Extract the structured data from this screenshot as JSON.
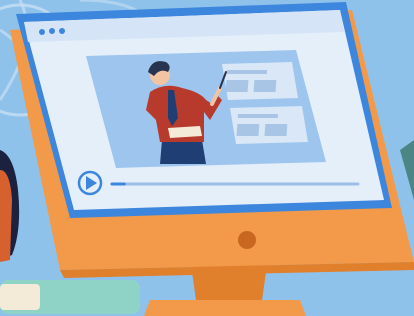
{
  "scene": {
    "description_icon": "e-learning-monitor-illustration",
    "colors": {
      "background": "#8fc2ea",
      "monitor_body": "#f29a4a",
      "monitor_body_dark": "#e07f2c",
      "bezel_blue": "#3d86dd",
      "screen": "#e4effa",
      "titlebar": "#d5e4f6",
      "video_area": "#9ec5ee",
      "slide_panel": "#d9e7f7",
      "slide_lines": "#a9c5e6",
      "shirt": "#b73a2c",
      "tie": "#1f3e73",
      "pants": "#1f3e73",
      "hair": "#27334f",
      "skin": "#f2c4a2",
      "play_button": "#3d86dd",
      "progress_track": "#9cbfe9",
      "progress_fill": "#3d86dd"
    }
  },
  "player": {
    "play_icon": "play-icon",
    "progress": 0.05
  }
}
